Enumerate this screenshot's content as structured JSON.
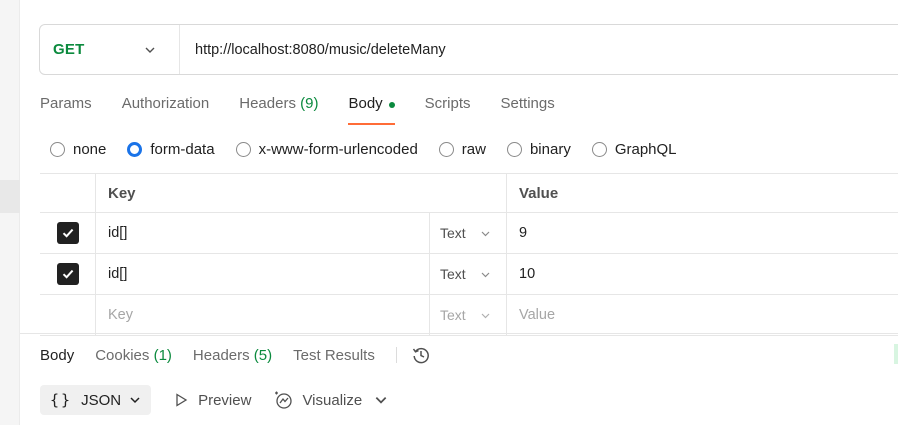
{
  "request": {
    "method": "GET",
    "url": "http://localhost:8080/music/deleteMany"
  },
  "request_tabs": [
    {
      "label": "Params"
    },
    {
      "label": "Authorization"
    },
    {
      "label": "Headers",
      "count": "(9)"
    },
    {
      "label": "Body",
      "active": true,
      "indicator": "green-dot"
    },
    {
      "label": "Scripts"
    },
    {
      "label": "Settings"
    }
  ],
  "body_types": [
    {
      "label": "none",
      "selected": false
    },
    {
      "label": "form-data",
      "selected": true
    },
    {
      "label": "x-www-form-urlencoded",
      "selected": false
    },
    {
      "label": "raw",
      "selected": false
    },
    {
      "label": "binary",
      "selected": false
    },
    {
      "label": "GraphQL",
      "selected": false
    }
  ],
  "form_table": {
    "headers": {
      "key": "Key",
      "value": "Value"
    },
    "rows": [
      {
        "checked": true,
        "key": "id[]",
        "type": "Text",
        "value": "9"
      },
      {
        "checked": true,
        "key": "id[]",
        "type": "Text",
        "value": "10"
      }
    ],
    "placeholder_row": {
      "key": "Key",
      "type": "Text",
      "value": "Value"
    }
  },
  "response_tabs": [
    {
      "label": "Body",
      "active": true
    },
    {
      "label": "Cookies",
      "count": "(1)"
    },
    {
      "label": "Headers",
      "count": "(5)"
    },
    {
      "label": "Test Results"
    }
  ],
  "response_toolbar": {
    "format_braces": "{}",
    "format": "JSON",
    "preview": "Preview",
    "visualize": "Visualize"
  },
  "colors": {
    "method_get": "#0b8a3e",
    "active_tab_underline": "#ff6c37",
    "radio_selected": "#1a73e8",
    "count": "#0b8a3e"
  },
  "icons": [
    "chevron-down-icon",
    "checkbox-checked-icon",
    "history-icon",
    "play-icon",
    "visualize-icon"
  ]
}
